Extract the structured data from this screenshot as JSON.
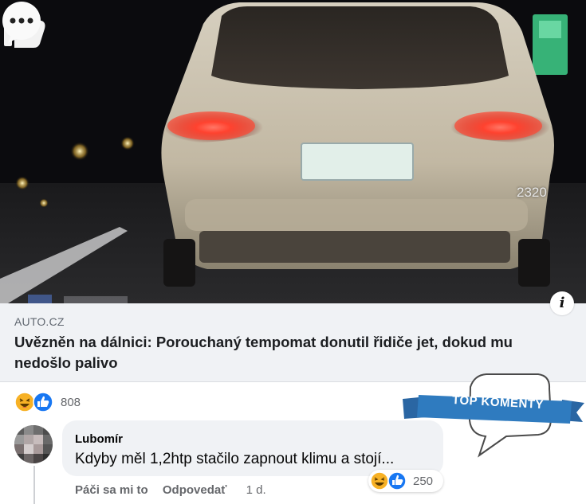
{
  "overlay": {
    "like_count": "2320",
    "second_count": "2..."
  },
  "link_preview": {
    "source": "AUTO.CZ",
    "headline": "Uvězněn na dálnici: Porouchaný tempomat donutil řidiče jet, dokud mu nedošlo palivo"
  },
  "post_reactions": {
    "icons": [
      "haha-icon",
      "like-icon"
    ],
    "count": "808"
  },
  "badge": {
    "label": "TOP KOMENTY",
    "color": "#2f7bbf"
  },
  "comment": {
    "author": "Lubomír",
    "text": "Kdyby měl 1,2htp stačilo zapnout klimu a stojí...",
    "reactions_count": "250",
    "reaction_icons": [
      "haha-icon",
      "like-icon"
    ],
    "actions": {
      "like": "Páči sa mi to",
      "reply": "Odpovedať",
      "time": "1 d."
    }
  },
  "colors": {
    "facebook_blue": "#1877f2",
    "haha_yellow": "#f7b125",
    "link_bg": "#f0f2f5",
    "secondary_text": "#65676b"
  }
}
